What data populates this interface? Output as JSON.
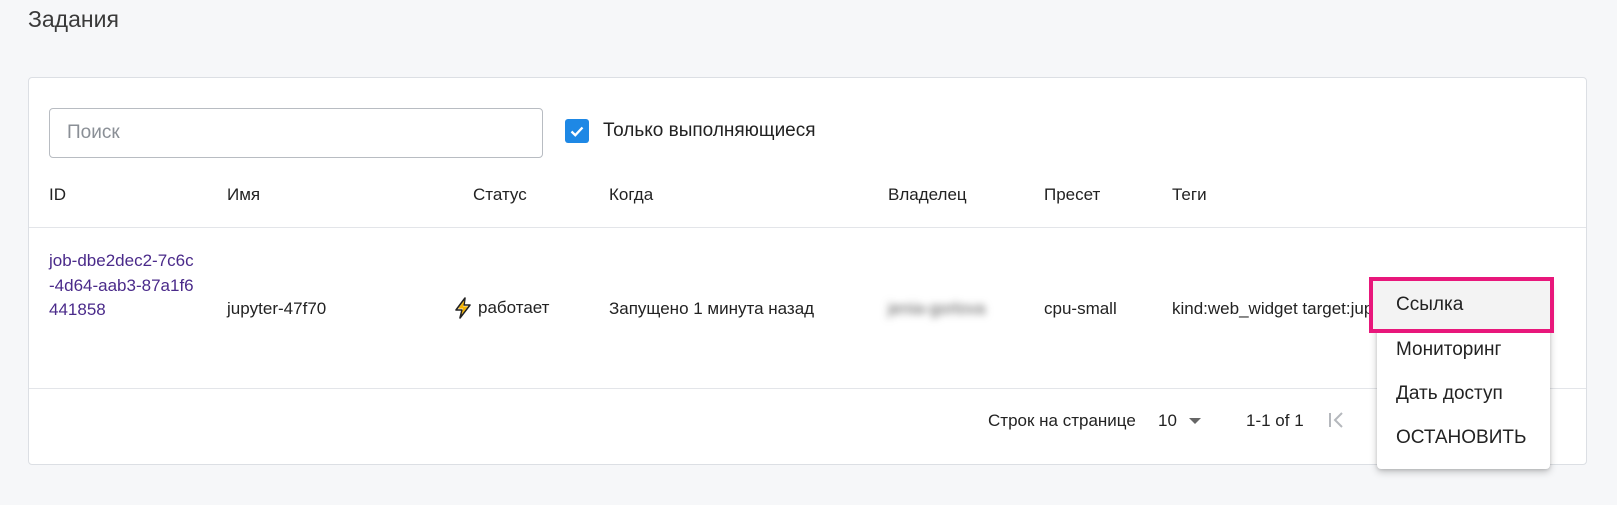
{
  "page": {
    "title": "Задания"
  },
  "filters": {
    "search_placeholder": "Поиск",
    "running_only_label": "Только выполняющиеся",
    "running_only_checked": true
  },
  "table": {
    "columns": [
      "ID",
      "Имя",
      "Статус",
      "Когда",
      "Владелец",
      "Пресет",
      "Теги"
    ],
    "rows": [
      {
        "id": "job-dbe2dec2-7c6c-4d64-aab3-87a1f6441858",
        "name": "jupyter-47f70",
        "status": "работает",
        "status_icon": "lightning-icon",
        "when": "Запущено 1 минута назад",
        "owner": "jenia-gorlova",
        "preset": "cpu-small",
        "tags": "kind:web_widget target:jup"
      }
    ]
  },
  "pagination": {
    "rows_per_page_label": "Строк на странице",
    "rows_per_page_value": "10",
    "range_text": "1-1 of 1"
  },
  "context_menu": {
    "items": [
      "Ссылка",
      "Мониторинг",
      "Дать доступ",
      "ОСТАНОВИТЬ"
    ],
    "highlighted_item": "Ссылка"
  },
  "colors": {
    "accent": "#1e88e5",
    "link": "#4a2a8a",
    "highlight_border": "#e8177b",
    "status_icon": "#f5b400"
  }
}
